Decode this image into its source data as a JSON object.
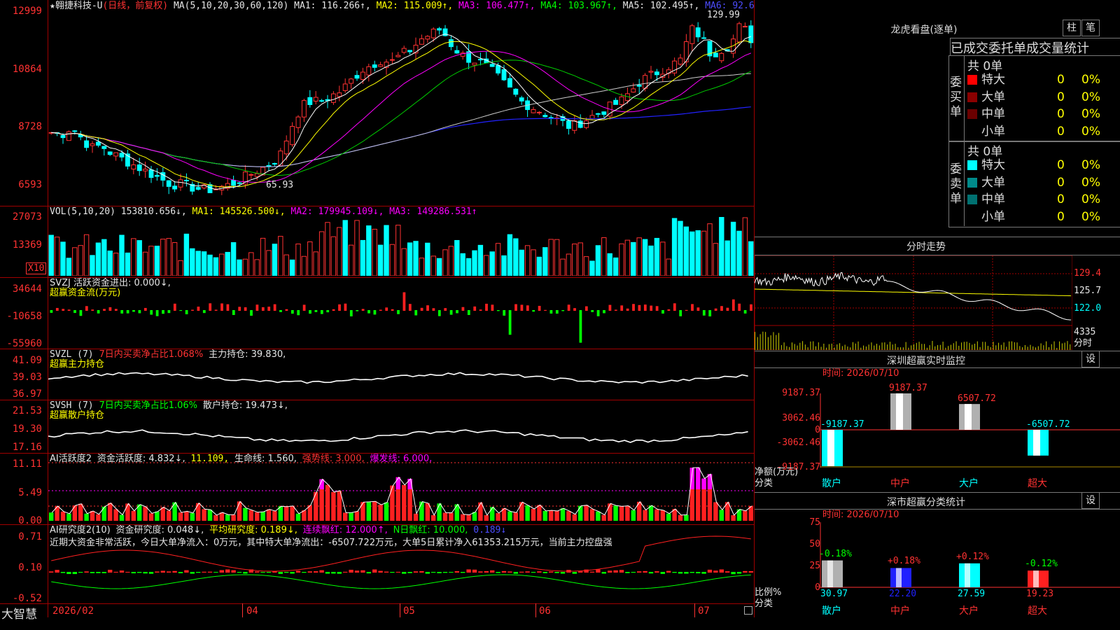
{
  "header": {
    "star": "★",
    "stock_name": "翱捷科技-U",
    "period": "(日线，前复权)",
    "ma_params": "MA(5,10,20,30,60,120)",
    "ma1": "MA1: 116.266↑,",
    "ma2": "MA2: 115.009↑,",
    "ma3": "MA3: 106.477↑,",
    "ma4": "MA4: 103.967↑,",
    "ma5": "MA5: 102.495↑,",
    "ma6": "MA6: 92.6"
  },
  "price_axis": [
    "12999",
    "10864",
    "8728",
    "6593"
  ],
  "price_annotations": {
    "high": "129.99",
    "low": "65.93"
  },
  "vol": {
    "label": "VOL(5,10,20)",
    "value": "153810.656↓,",
    "ma1": "MA1: 145526.500↓,",
    "ma2": "MA2: 179945.109↓,",
    "ma3": "MA3: 149286.531↑",
    "axis": [
      "27073",
      "13369"
    ],
    "unit": "X10"
  },
  "svzj": {
    "label": "SVZJ  活跃资金进出: 0.000↓,",
    "sub": "超赢资金流(万元)",
    "axis": [
      "34644",
      "-10658",
      "-55960"
    ]
  },
  "svzl": {
    "label": "SVZL (7)",
    "ratio": "7日内买卖净占比1.068%",
    "pos": "主力持仓: 39.830,",
    "sub": "超赢主力持仓",
    "axis": [
      "41.09",
      "39.03",
      "36.97"
    ]
  },
  "svsh": {
    "label": "SVSH (7)",
    "ratio": "7日内买卖净占比1.06%",
    "pos": "散户持仓: 19.473↓,",
    "sub": "超赢散户持仓",
    "axis": [
      "21.53",
      "19.30",
      "17.16"
    ]
  },
  "ai1": {
    "label": "AI活跃度2",
    "a": "资金活跃度: 4.832↓,",
    "b": "11.109,",
    "c": "生命线: 1.560,",
    "d": "强势线: 3.000,",
    "e": "爆发线: 6.000,",
    "axis": [
      "11.11",
      "5.49",
      "0.00"
    ]
  },
  "ai2": {
    "label": "AI研究度2(10)",
    "a": "资金研究度: 0.048↓,",
    "b": "平均研究度: 0.189↓,",
    "c": "连续飘红: 12.000↑,",
    "d": "N日飘红: 10.000,",
    "e": "0.189↓",
    "note": "近期大资金非常活跃，今日大单净流入：0万元，其中特大单净流出：-6507.722万元，大单5日累计净入61353.215万元，当前主力控盘强",
    "axis": [
      "0.71",
      "0.10",
      "-0.52"
    ]
  },
  "xaxis": {
    "brand": "大智慧",
    "labels": [
      "2026/02",
      "04",
      "05",
      "06",
      "07"
    ]
  },
  "right": {
    "lh_title": "龙虎看盘(逐单)",
    "btn_bar": "柱",
    "btn_bi": "笔",
    "table_header": "已成交委托单成交量统计",
    "buy_group": "委买单",
    "sell_group": "委卖单",
    "buy_total": "共 0单",
    "sell_total": "共 0单",
    "buy_rows": [
      {
        "label": "特大",
        "count": "0",
        "pct": "0%",
        "color": "#ff0000"
      },
      {
        "label": "大单",
        "count": "0",
        "pct": "0%",
        "color": "#8b0000"
      },
      {
        "label": "中单",
        "count": "0",
        "pct": "0%",
        "color": "#6b0000"
      },
      {
        "label": "小单",
        "count": "0",
        "pct": "0%",
        "color": "#000000"
      }
    ],
    "sell_rows": [
      {
        "label": "特大",
        "count": "0",
        "pct": "0%",
        "color": "#00ffff"
      },
      {
        "label": "大单",
        "count": "0",
        "pct": "0%",
        "color": "#008b8b"
      },
      {
        "label": "中单",
        "count": "0",
        "pct": "0%",
        "color": "#007070"
      },
      {
        "label": "小单",
        "count": "0",
        "pct": "0%",
        "color": "#000000"
      }
    ],
    "intraday_title": "分时走势",
    "intraday_axis": [
      "129.4",
      "125.7",
      "122.0",
      "4335"
    ],
    "intraday_unit": "分时",
    "sz_title": "深圳超赢实时监控",
    "sz_btn": "设",
    "sz_date": "时间: 2026/07/10",
    "sz_axis": [
      "9187.37",
      "3062.46",
      "0",
      "-3062.46",
      "-9187.37"
    ],
    "sz_ylabel1": "净额(万元)",
    "sz_ylabel2": "分类",
    "sz_bars": [
      {
        "label": "散户",
        "value": -9187.37,
        "text": "-9187.37"
      },
      {
        "label": "中户",
        "value": 9187.37,
        "text": "9187.37"
      },
      {
        "label": "大户",
        "value": 6507.72,
        "text": "6507.72"
      },
      {
        "label": "超大",
        "value": -6507.72,
        "text": "-6507.72"
      }
    ],
    "cl_title": "深市超赢分类统计",
    "cl_btn": "设",
    "cl_date": "时间: 2026/07/10",
    "cl_axis": [
      "75",
      "50",
      "25",
      "0"
    ],
    "cl_ylabel1": "比例%",
    "cl_ylabel2": "分类",
    "cl_bars": [
      {
        "label": "散户",
        "value": 30.97,
        "text": "30.97",
        "delta": "-0.18%"
      },
      {
        "label": "中户",
        "value": 22.2,
        "text": "22.20",
        "delta": "+0.18%"
      },
      {
        "label": "大户",
        "value": 27.59,
        "text": "27.59",
        "delta": "+0.12%"
      },
      {
        "label": "超大",
        "value": 19.23,
        "text": "19.23",
        "delta": "-0.12%"
      }
    ]
  }
}
